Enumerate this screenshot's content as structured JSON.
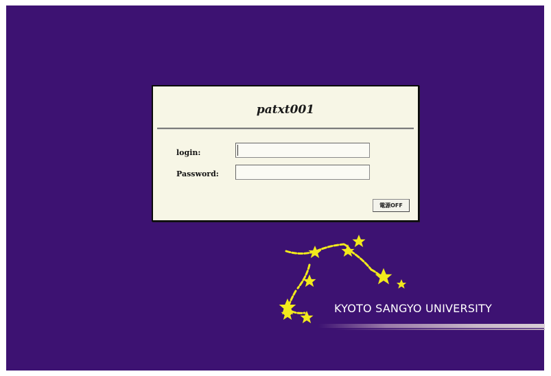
{
  "login_dialog": {
    "hostname": "patxt001",
    "login_label": "login:",
    "login_value": "",
    "password_label": "Password:",
    "password_value": "",
    "power_button_label": "電源OFF"
  },
  "branding": {
    "university_name": "KYOTO SANGYO UNIVERSITY",
    "logo_icon": "constellation-stars-icon"
  },
  "colors": {
    "background": "#3d1272",
    "dialog_background": "#f7f6e6",
    "star": "#f2ea1c",
    "brand_text": "#ffffff"
  }
}
